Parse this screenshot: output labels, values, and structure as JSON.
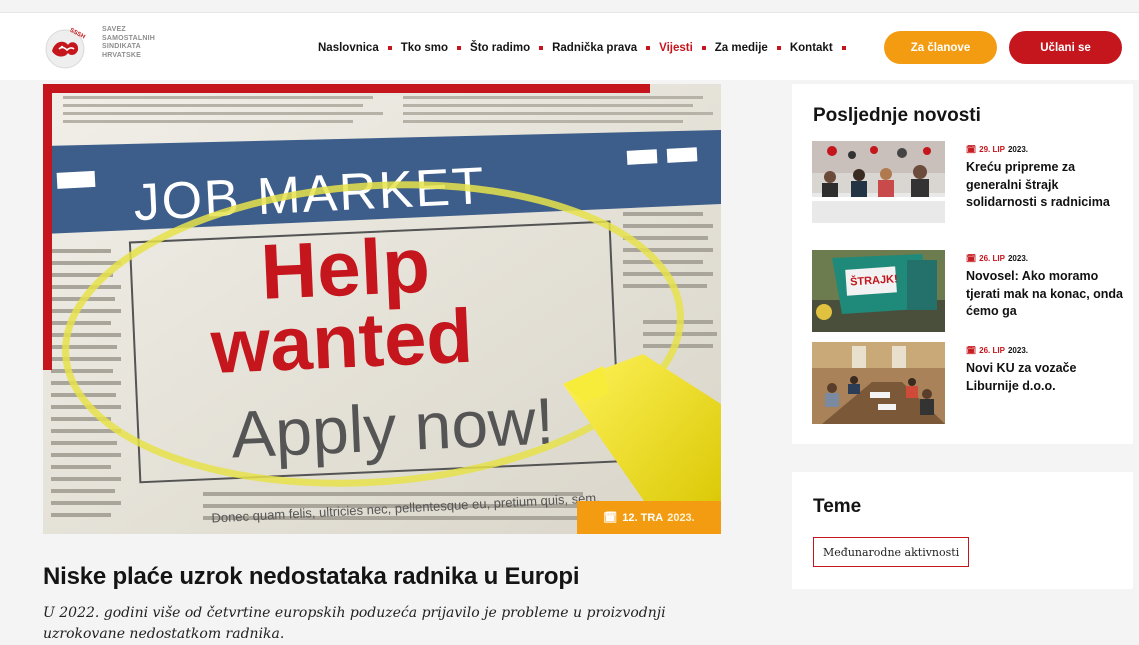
{
  "brand": {
    "logo_lines": [
      "SAVEZ",
      "SAMOSTALNIH",
      "SINDIKATA",
      "HRVATSKE"
    ],
    "logo_arc_text": "SSSH",
    "colors": {
      "red": "#c4161c",
      "orange": "#f39c12"
    }
  },
  "nav": {
    "items": [
      "Naslovnica",
      "Tko smo",
      "Što radimo",
      "Radnička prava",
      "Vijesti",
      "Za medije",
      "Kontakt"
    ],
    "active": "Vijesti"
  },
  "buttons": {
    "members": "Za članove",
    "join": "Učlani se"
  },
  "featured": {
    "image_text": {
      "header": "JOB MARKET",
      "line1": "Help",
      "line2": "wanted",
      "line3": "Apply now!"
    },
    "date": {
      "day": "12.",
      "month": "TRA",
      "year": "2023."
    },
    "title": "Niske plaće uzrok nedostataka radnika u Europi",
    "lead": "U 2022. godini više od četvrtine europskih poduzeća prijavilo je probleme u proizvodnji uzrokovane nedostatkom radnika."
  },
  "latest": {
    "heading": "Posljednje novosti",
    "items": [
      {
        "day": "29.",
        "month": "LIP",
        "year": "2023.",
        "title": "Kreću pripreme za generalni štrajk solidarnosti s radnicima",
        "thumb_icon": "press-conference-photo"
      },
      {
        "day": "26.",
        "month": "LIP",
        "year": "2023.",
        "title": "Novosel: Ako moramo tjerati mak na konac, onda ćemo ga",
        "thumb_icon": "strike-banner-photo",
        "thumb_text": "ŠTRAJK!"
      },
      {
        "day": "26.",
        "month": "LIP",
        "year": "2023.",
        "title": "Novi KU za vozače Liburnije d.o.o.",
        "thumb_icon": "meeting-table-photo"
      }
    ]
  },
  "topics": {
    "heading": "Teme",
    "tags": [
      "Međunarodne aktivnosti"
    ]
  }
}
